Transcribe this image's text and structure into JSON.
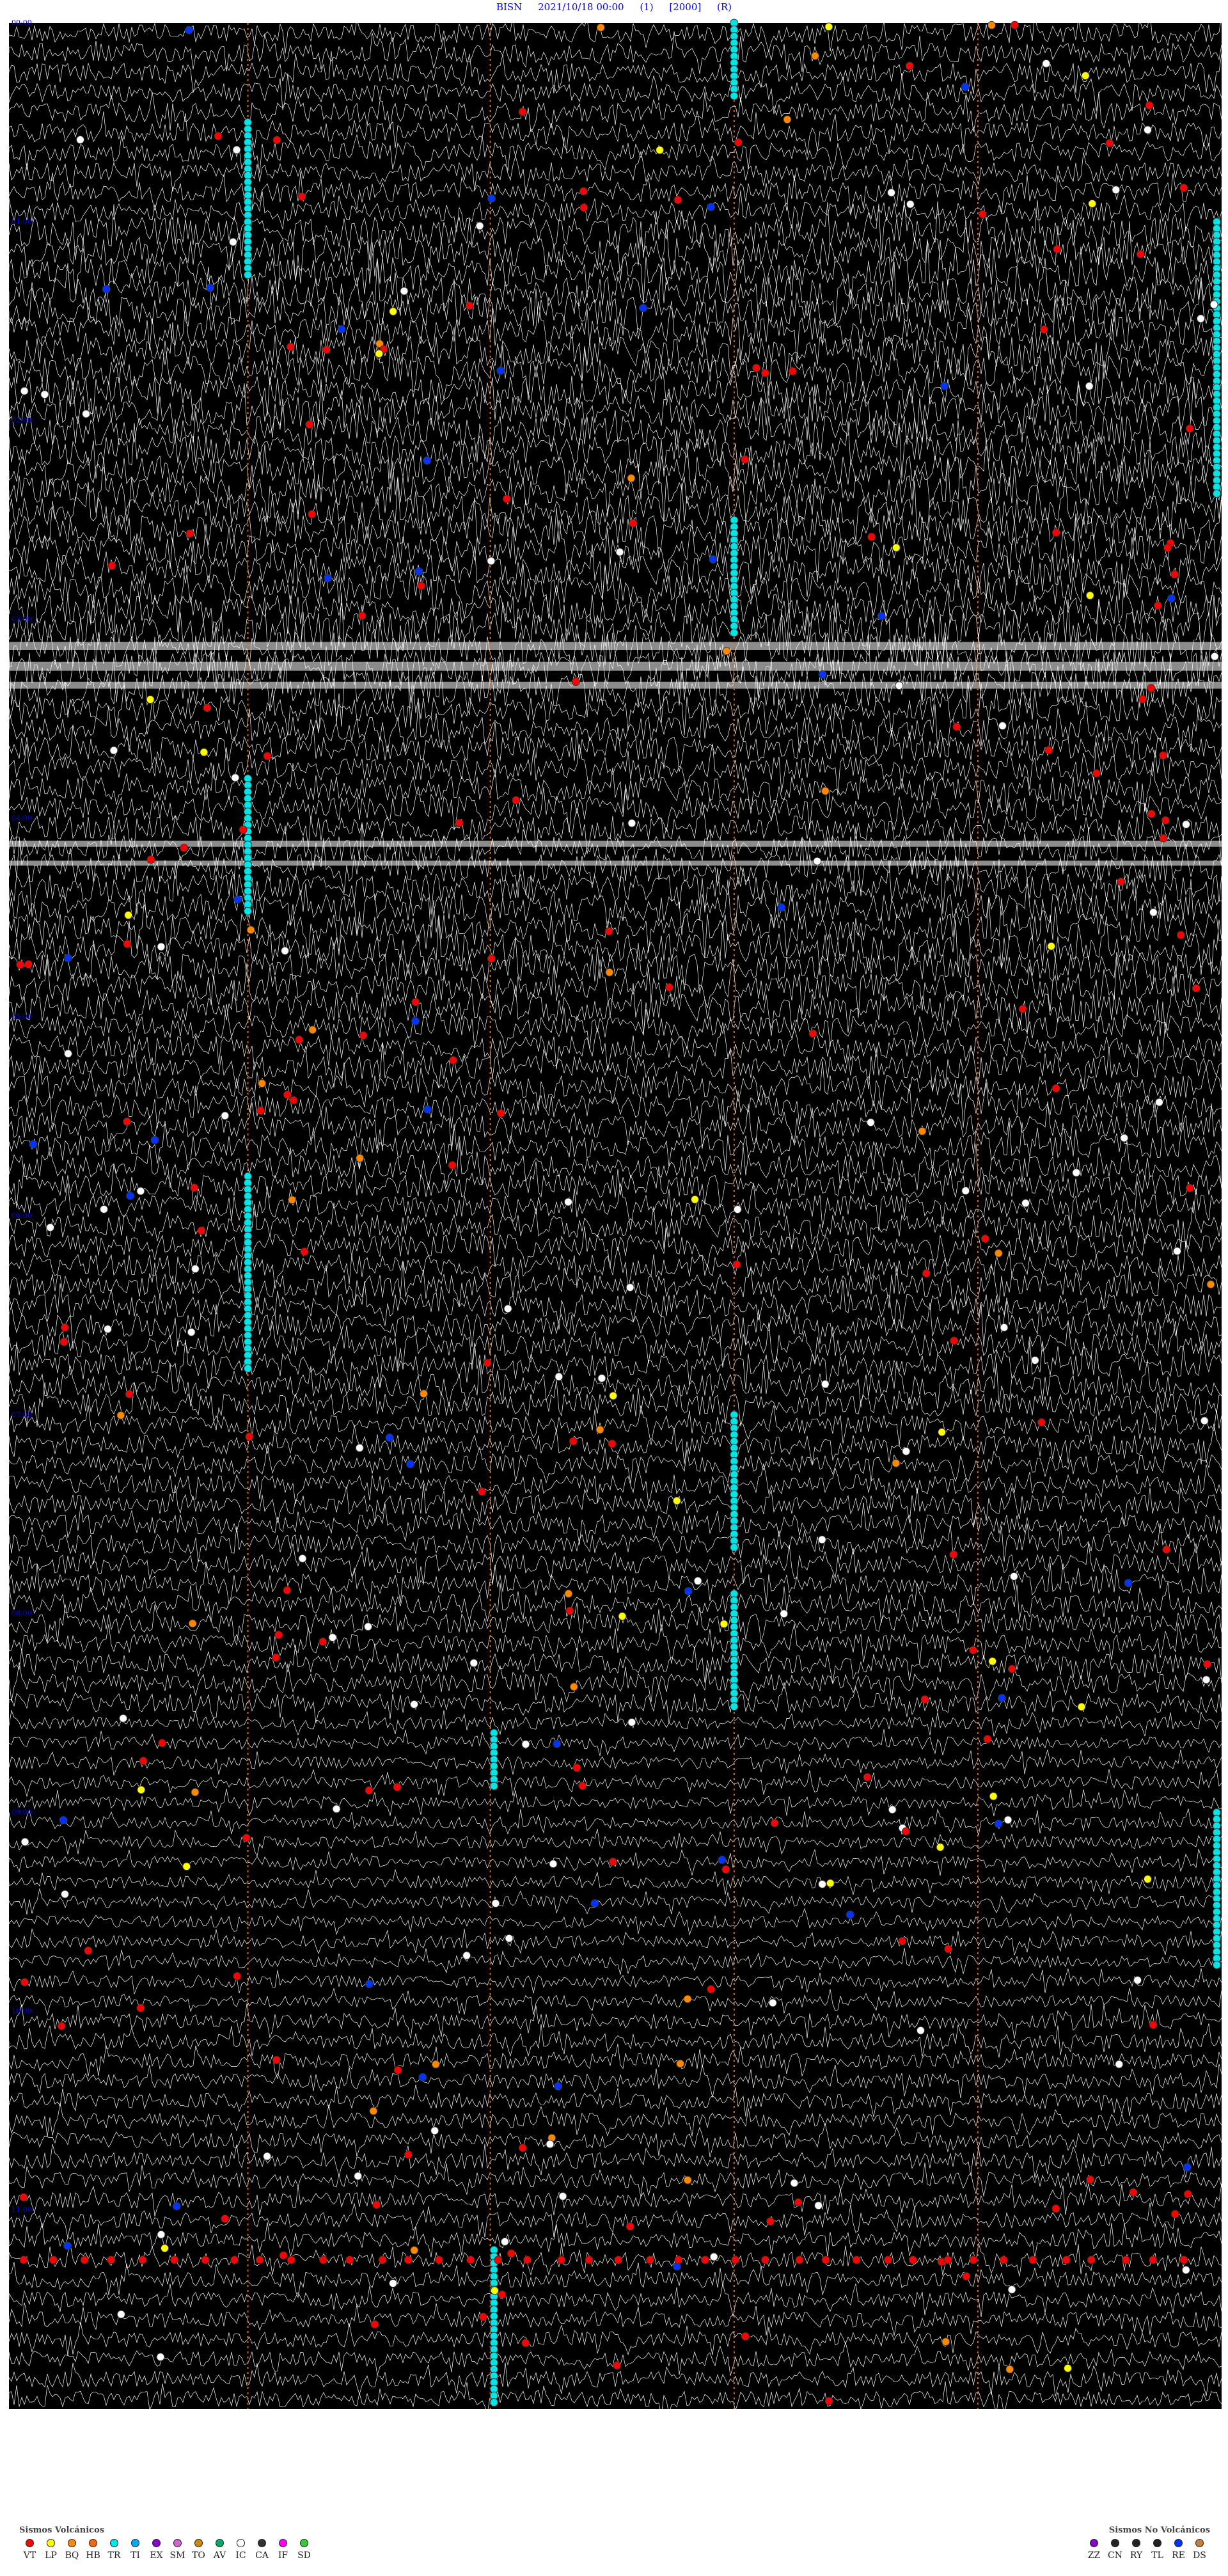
{
  "header": {
    "station": "BISN",
    "datetime": "2021/10/18 00:00",
    "channel": "(1)",
    "gain": "[2000]",
    "component": "(R)"
  },
  "chart_data": {
    "type": "helicorder",
    "rows": 120,
    "time_labels": [
      "00:00",
      "01:00",
      "02:00",
      "03:00",
      "04:00",
      "05:00",
      "06:00",
      "07:00",
      "08:00",
      "09:00",
      "10:00",
      "11:00"
    ],
    "minute_marks_fraction": [
      0.2,
      0.4,
      0.6,
      0.8
    ],
    "colors": {
      "background": "#000000",
      "trace": "#ffffff",
      "minute_line": "#d2691e",
      "time_label": "#0000ff",
      "VT": "#ff0000",
      "LP": "#ffff00",
      "TR": "#00e5e5",
      "BQ": "#ff8800",
      "IC": "#ffffff",
      "RE": "#0033ff",
      "DS": "#c08040",
      "AV": "#00aa66"
    }
  },
  "legend_volcanic": {
    "title": "Sismos Volcánicos",
    "items": [
      {
        "code": "VT",
        "color": "#ff0000"
      },
      {
        "code": "LP",
        "color": "#ffff00"
      },
      {
        "code": "BQ",
        "color": "#ff8800"
      },
      {
        "code": "HB",
        "color": "#ff6600"
      },
      {
        "code": "TR",
        "color": "#00e5e5"
      },
      {
        "code": "TI",
        "color": "#00aaff"
      },
      {
        "code": "EX",
        "color": "#8800cc"
      },
      {
        "code": "SM",
        "color": "#cc66cc"
      },
      {
        "code": "TO",
        "color": "#cc8800"
      },
      {
        "code": "AV",
        "color": "#00aa66"
      },
      {
        "code": "IC",
        "color": "#ffffff"
      },
      {
        "code": "CA",
        "color": "#333333"
      },
      {
        "code": "IF",
        "color": "#ff00ff"
      },
      {
        "code": "SD",
        "color": "#33cc33"
      }
    ]
  },
  "legend_nonvolcanic": {
    "title": "Sismos No Volcánicos",
    "items": [
      {
        "code": "ZZ",
        "color": "#8800cc"
      },
      {
        "code": "CN",
        "color": "#222222"
      },
      {
        "code": "RY",
        "color": "#222222"
      },
      {
        "code": "TL",
        "color": "#222222"
      },
      {
        "code": "RE",
        "color": "#0033ff"
      },
      {
        "code": "DS",
        "color": "#c08040"
      }
    ]
  }
}
